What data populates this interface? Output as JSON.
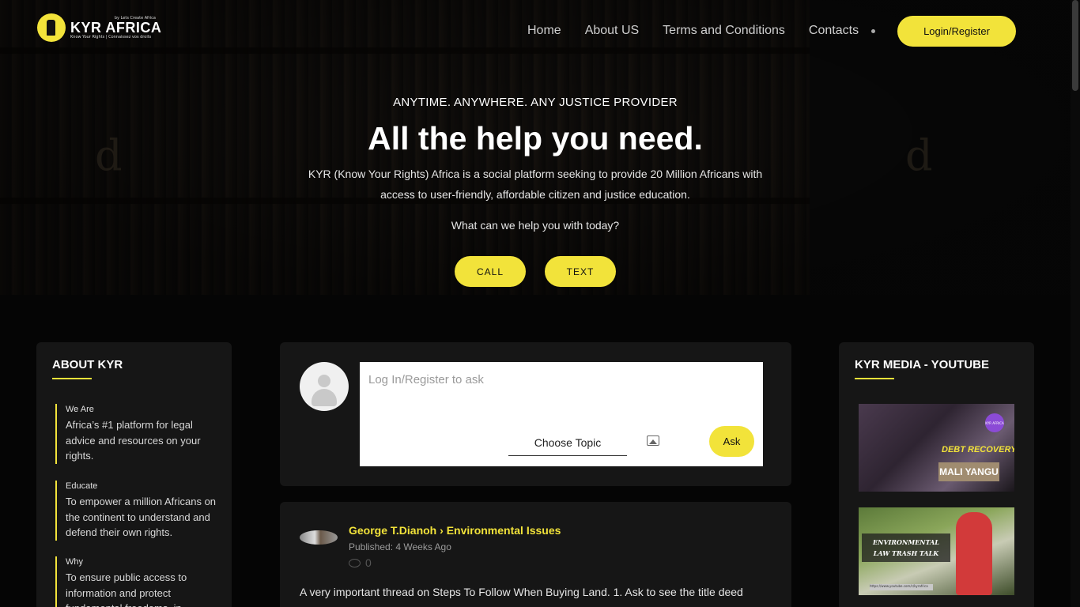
{
  "brand": {
    "by_line": "by Lets Create Africa",
    "name": "KYR AFRICA",
    "tagline": "Know Your Rights | Connaissez vos droits"
  },
  "nav": {
    "items": [
      "Home",
      "About US",
      "Terms and Conditions",
      "Contacts"
    ],
    "login_label": "Login/Register"
  },
  "hero": {
    "kicker": "ANYTIME. ANYWHERE. ANY JUSTICE PROVIDER",
    "title": "All the help you need.",
    "description": "KYR (Know Your Rights) Africa is a social platform seeking to provide 20 Million Africans with access to user-friendly, affordable citizen and justice education.",
    "question": "What can we help you with today?",
    "call_label": "CALL",
    "text_label": "TEXT",
    "deco_letter": "d"
  },
  "about": {
    "title": "ABOUT KYR",
    "items": [
      {
        "label": "We Are",
        "text": "Africa’s #1 platform for legal advice and resources on your rights."
      },
      {
        "label": "Educate",
        "text": "To empower a million Africans on the continent to understand and defend their own rights."
      },
      {
        "label": "Why",
        "text": "To ensure public access to information and protect fundamental freedoms, in"
      }
    ]
  },
  "ask": {
    "placeholder": "Log In/Register to ask",
    "topic_label": "Choose Topic",
    "ask_label": "Ask"
  },
  "post": {
    "author": "George T.Dianoh",
    "topic": "Environmental Issues",
    "published": "Published: 4 Weeks Ago",
    "comments": "0",
    "body": "A very important thread on Steps To Follow When Buying Land. 1. Ask to see the title deed"
  },
  "media": {
    "title": "KYR MEDIA - YOUTUBE",
    "videos": [
      {
        "badge": "KYR AFRICA",
        "caption1": "DEBT RECOVERY",
        "caption2": "MALI YANGU"
      },
      {
        "caption": "ENVIRONMENTAL LAW TRASH TALK",
        "url": "https://www.youtube.com/c/kyrafrica"
      }
    ]
  },
  "colors": {
    "accent": "#f2e33a",
    "background": "#050505",
    "panel": "#161616"
  }
}
